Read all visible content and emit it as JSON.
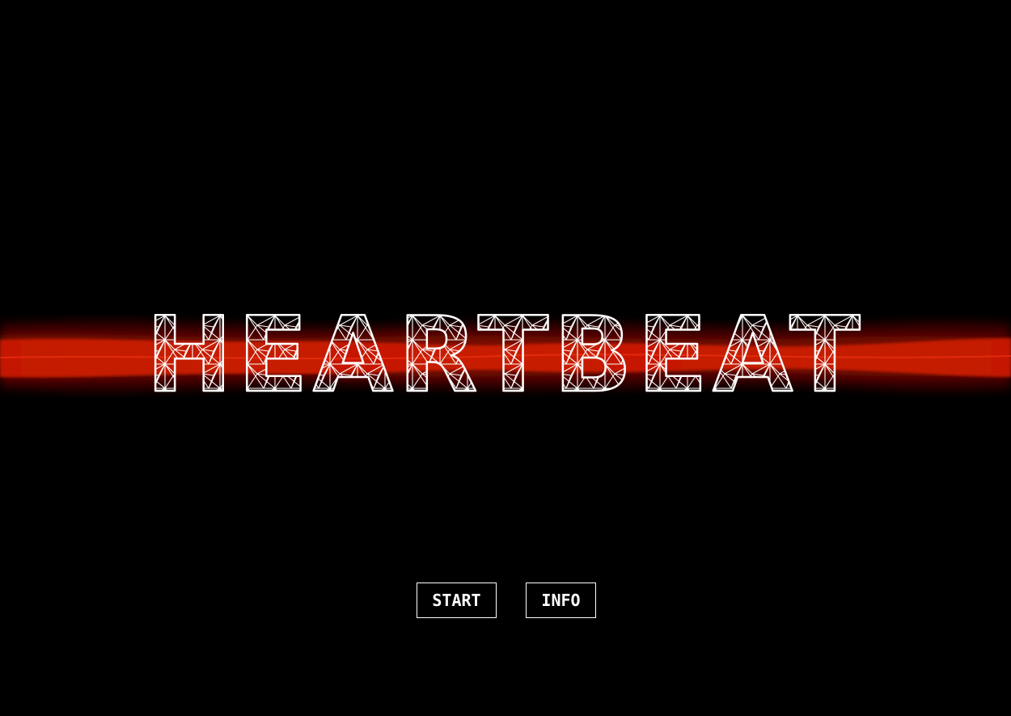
{
  "title": {
    "text": "HEARTBEAT"
  },
  "menu": {
    "start_label": "START",
    "info_label": "INFO"
  },
  "colors": {
    "background": "#000000",
    "pulse": "#c81a06",
    "pulse_glow": "#5a0a02",
    "mesh": "#ffffff",
    "button_border": "#ffffff",
    "button_text": "#ffffff"
  }
}
